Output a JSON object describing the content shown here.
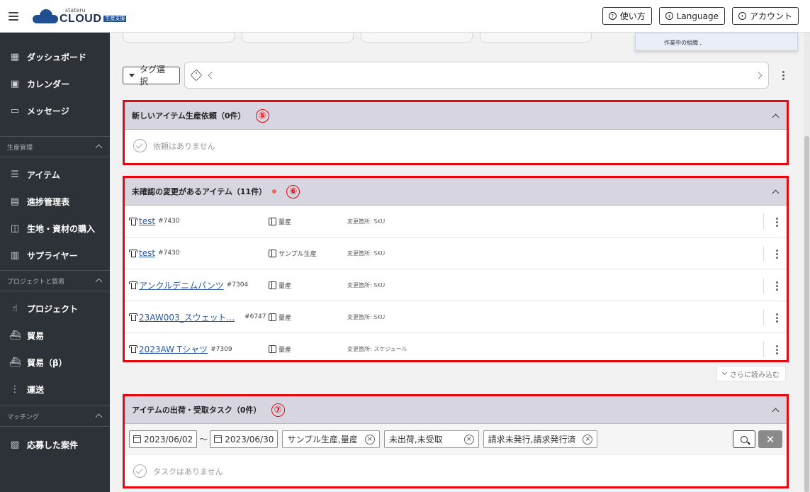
{
  "header": {
    "logo_small": "stateru",
    "logo_main": "CLOUD",
    "logo_tag": "生産支援",
    "help_label": "使い方",
    "language_label": "Language",
    "account_label": "アカウント"
  },
  "sidebar": {
    "top_items": [
      {
        "label": "ダッシュボード"
      },
      {
        "label": "カレンダー"
      },
      {
        "label": "メッセージ"
      }
    ],
    "sections": [
      {
        "title": "生産管理",
        "items": [
          {
            "label": "アイテム"
          },
          {
            "label": "進捗管理表"
          },
          {
            "label": "生地・資材の購入"
          },
          {
            "label": "サプライヤー"
          }
        ]
      },
      {
        "title": "プロジェクトと貿易",
        "items": [
          {
            "label": "プロジェクト"
          },
          {
            "label": "貿易"
          },
          {
            "label": "貿易（β）"
          },
          {
            "label": "運送"
          }
        ]
      },
      {
        "title": "マッチング",
        "items": [
          {
            "label": "応募した案件"
          }
        ]
      }
    ]
  },
  "float_panel": {
    "text": "作業中の組織 ,"
  },
  "tagbar": {
    "tag_select_label": "タグ選択"
  },
  "panels": {
    "new_requests": {
      "title": "新しいアイテム生産依頼（0件）",
      "marker": "⑤",
      "empty_text": "依頼はありません"
    },
    "unconfirmed": {
      "title": "未確認の変更があるアイテム（11件）",
      "marker": "⑥",
      "rows": [
        {
          "name": "test",
          "num": "#7430",
          "type": "量産",
          "change": "変更箇所: SKU"
        },
        {
          "name": "test",
          "num": "#7430",
          "type": "サンプル生産",
          "change": "変更箇所: SKU"
        },
        {
          "name": "アンクルデニムパンツ",
          "num": "#7304",
          "type": "量産",
          "change": "変更箇所: SKU"
        },
        {
          "name": "23AW003_スウェット...",
          "num": "#6747",
          "type": "量産",
          "change": "変更箇所: SKU"
        },
        {
          "name": "2023AW Tシャツ",
          "num": "#7309",
          "type": "量産",
          "change": "変更箇所: スケジュール"
        }
      ],
      "more_label": "さらに読み込む"
    },
    "shipping": {
      "title": "アイテムの出荷・受取タスク（0件）",
      "marker": "⑦",
      "date_from": "2023/06/02",
      "date_sep": "～",
      "date_to": "2023/06/30",
      "chips": [
        "サンプル生産,量産",
        "未出荷,未受取",
        "請求未発行,請求発行済"
      ],
      "empty_text": "タスクはありません"
    }
  }
}
